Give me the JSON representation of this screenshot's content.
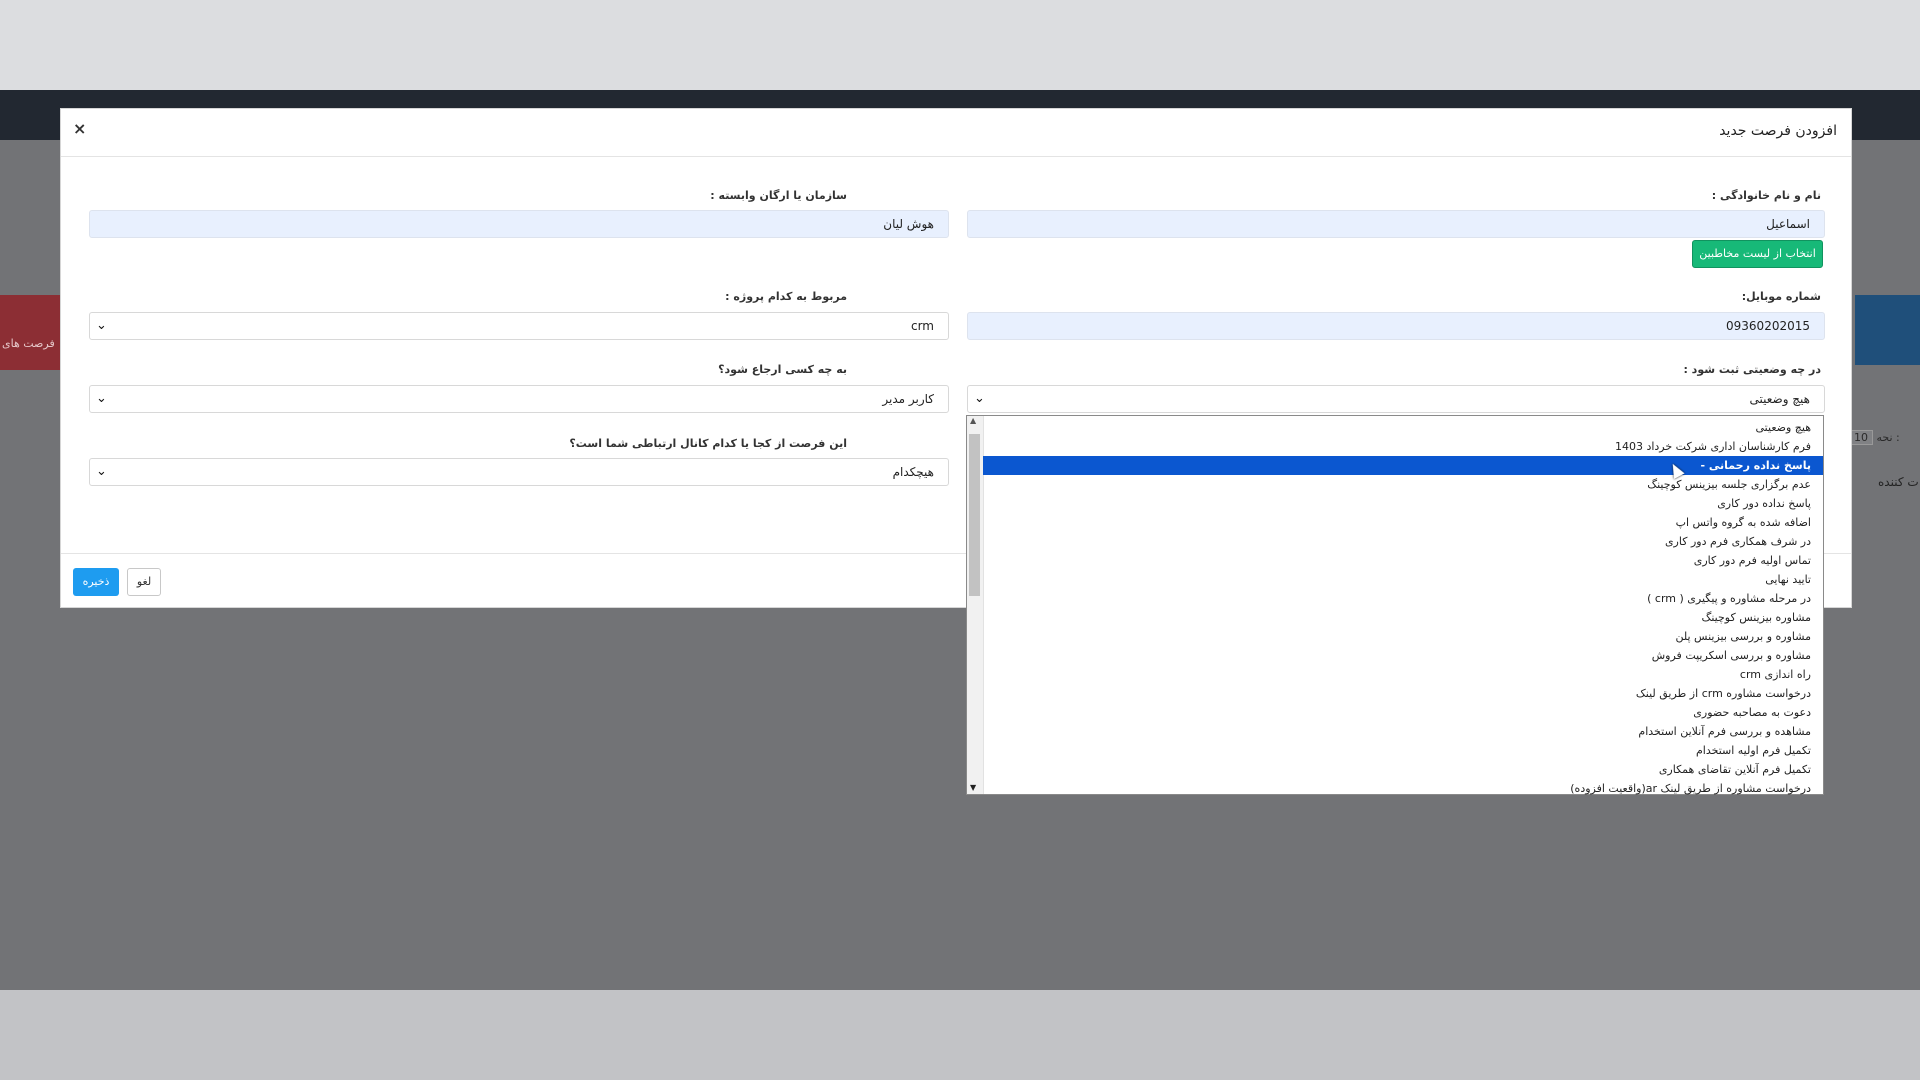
{
  "background": {
    "side_card_label": "فرصت های",
    "pager_label": "نحه :",
    "pager_value": "10",
    "column_label": "ت کننده"
  },
  "modal": {
    "title": "افزودن فرصت جدید",
    "close_glyph": "×",
    "left_column": {
      "organization": {
        "label": "سازمان یا ارگان وابسته :",
        "value": "هوش لیان"
      },
      "project": {
        "label": "مربوط به کدام پروژه :",
        "value": "crm"
      },
      "assignee": {
        "label": "به چه کسی ارجاع شود؟",
        "value": "کاربر مدیر"
      },
      "source": {
        "label": "این فرصت از کجا یا کدام کانال ارتباطی شما است؟",
        "value": "هیچکدام"
      }
    },
    "right_column": {
      "full_name": {
        "label": "نام و نام خانوادگی :",
        "value": "اسماعیل"
      },
      "select_contact_button": "انتخاب از لیست مخاطبین",
      "mobile": {
        "label": "شماره موبایل:",
        "value": "09360202015"
      },
      "status": {
        "label": "در چه وضعیتی ثبت شود :",
        "value": "هیچ وضعیتی"
      }
    },
    "footer": {
      "save_label": "ذخیره",
      "cancel_label": "لغو"
    }
  },
  "status_dropdown": {
    "selected_index": 2,
    "options": [
      "هیچ وضعیتی",
      "فرم کارشناسان اداری شرکت خرداد 1403",
      "پاسخ نداده رحمانی -",
      "عدم برگزاری جلسه بیزینس کوچینگ",
      "پاسخ نداده دور کاری",
      "اضافه شده به گروه واتس اپ",
      "در شرف همکاری فرم دور کاری",
      "تماس اولیه فرم دور کاری",
      "تایید نهایی",
      "در مرحله مشاوره و پیگیری ( crm )",
      "مشاوره بیزینس کوچینگ",
      "مشاوره و بررسی بیزینس پلن",
      "مشاوره و بررسی اسکریپت فروش",
      "راه اندازی crm",
      "درخواست مشاوره crm از طریق لینک",
      "دعوت به مصاحبه حضوری",
      "مشاهده و بررسی فرم آنلاین استخدام",
      "تکمیل فرم اولیه استخدام",
      "تکمیل فرم آنلاین تقاضای همکاری",
      "درخواست مشاوره از طریق لینک ar(واقعیت افزوده)"
    ]
  }
}
